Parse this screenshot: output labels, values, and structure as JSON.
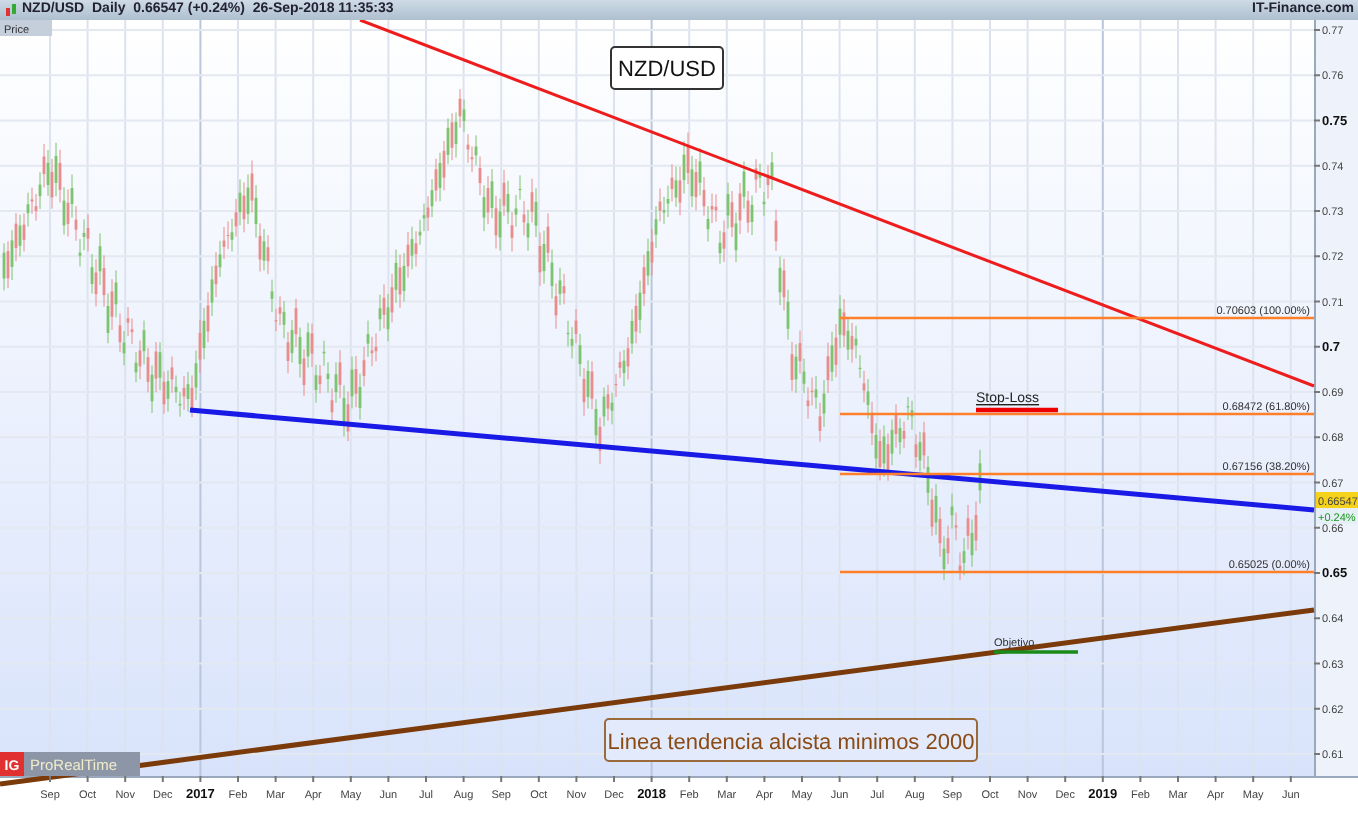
{
  "header": {
    "symbol": "NZD/USD",
    "period": "Daily",
    "quote": "0.66547 (+0.24%)",
    "timestamp": "26-Sep-2018 11:35:33",
    "source": "IT-Finance.com"
  },
  "chart": {
    "axis_label": "Price",
    "title": "NZD/USD",
    "y_ticks": [
      {
        "label": "0.77",
        "major": false
      },
      {
        "label": "0.76",
        "major": false
      },
      {
        "label": "0.75",
        "major": true
      },
      {
        "label": "0.74",
        "major": false
      },
      {
        "label": "0.73",
        "major": false
      },
      {
        "label": "0.72",
        "major": false
      },
      {
        "label": "0.71",
        "major": false
      },
      {
        "label": "0.7",
        "major": true
      },
      {
        "label": "0.69",
        "major": false
      },
      {
        "label": "0.68",
        "major": false
      },
      {
        "label": "0.67",
        "major": false
      },
      {
        "label": "0.66",
        "major": false
      },
      {
        "label": "0.65",
        "major": true
      },
      {
        "label": "0.64",
        "major": false
      },
      {
        "label": "0.63",
        "major": false
      },
      {
        "label": "0.62",
        "major": false
      },
      {
        "label": "0.61",
        "major": false
      }
    ],
    "x_ticks": [
      {
        "label": "Sep",
        "major": false
      },
      {
        "label": "Oct",
        "major": false
      },
      {
        "label": "Nov",
        "major": false
      },
      {
        "label": "Dec",
        "major": false
      },
      {
        "label": "2017",
        "major": true
      },
      {
        "label": "Feb",
        "major": false
      },
      {
        "label": "Mar",
        "major": false
      },
      {
        "label": "Apr",
        "major": false
      },
      {
        "label": "May",
        "major": false
      },
      {
        "label": "Jun",
        "major": false
      },
      {
        "label": "Jul",
        "major": false
      },
      {
        "label": "Aug",
        "major": false
      },
      {
        "label": "Sep",
        "major": false
      },
      {
        "label": "Oct",
        "major": false
      },
      {
        "label": "Nov",
        "major": false
      },
      {
        "label": "Dec",
        "major": false
      },
      {
        "label": "2018",
        "major": true
      },
      {
        "label": "Feb",
        "major": false
      },
      {
        "label": "Mar",
        "major": false
      },
      {
        "label": "Apr",
        "major": false
      },
      {
        "label": "May",
        "major": false
      },
      {
        "label": "Jun",
        "major": false
      },
      {
        "label": "Jul",
        "major": false
      },
      {
        "label": "Aug",
        "major": false
      },
      {
        "label": "Sep",
        "major": false
      },
      {
        "label": "Oct",
        "major": false
      },
      {
        "label": "Nov",
        "major": false
      },
      {
        "label": "Dec",
        "major": false
      },
      {
        "label": "2019",
        "major": true
      },
      {
        "label": "Feb",
        "major": false
      },
      {
        "label": "Mar",
        "major": false
      },
      {
        "label": "Apr",
        "major": false
      },
      {
        "label": "May",
        "major": false
      },
      {
        "label": "Jun",
        "major": false
      }
    ],
    "last_price": {
      "value": "0.66547",
      "change": "+0.24%"
    },
    "fib_levels": [
      {
        "label": "0.70603 (100.00%)"
      },
      {
        "label": "0.68472 (61.80%)"
      },
      {
        "label": "0.67156 (38.20%)"
      },
      {
        "label": "0.65025 (0.00%)"
      }
    ],
    "annotations": [
      {
        "kind": "stop_loss",
        "text": "Stop-Loss"
      },
      {
        "kind": "target",
        "text": "Objetivo"
      },
      {
        "kind": "note",
        "text": "Linea tendencia alcista minimos 2000"
      }
    ]
  },
  "logo": {
    "badge": "IG",
    "name": "ProRealTime"
  }
}
